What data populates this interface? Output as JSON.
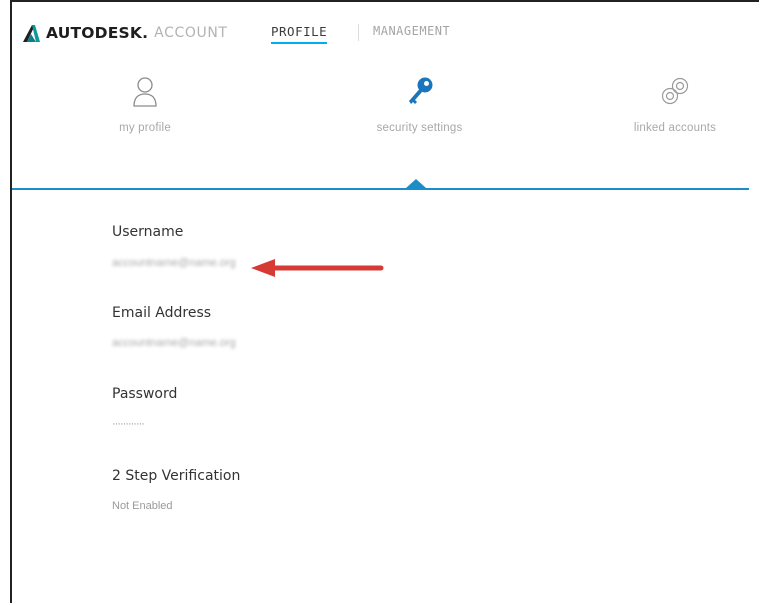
{
  "header": {
    "brand": "AUTODESK.",
    "brand_sub": "ACCOUNT",
    "nav": {
      "profile": "PROFILE",
      "management": "MANAGEMENT"
    }
  },
  "tabs": [
    {
      "label": "my profile",
      "icon": "user-icon"
    },
    {
      "label": "security settings",
      "icon": "key-icon",
      "active": true
    },
    {
      "label": "linked accounts",
      "icon": "link-icon"
    }
  ],
  "fields": {
    "username": {
      "label": "Username",
      "value": "accountname@name.org"
    },
    "email": {
      "label": "Email Address",
      "value": "accountname@name.org"
    },
    "password": {
      "label": "Password",
      "value": "············"
    },
    "two_step": {
      "label": "2 Step Verification",
      "value": "Not Enabled"
    }
  },
  "colors": {
    "accent": "#1b8dc9",
    "brand_teal": "#0a9a9a",
    "arrow": "#d63a35"
  }
}
